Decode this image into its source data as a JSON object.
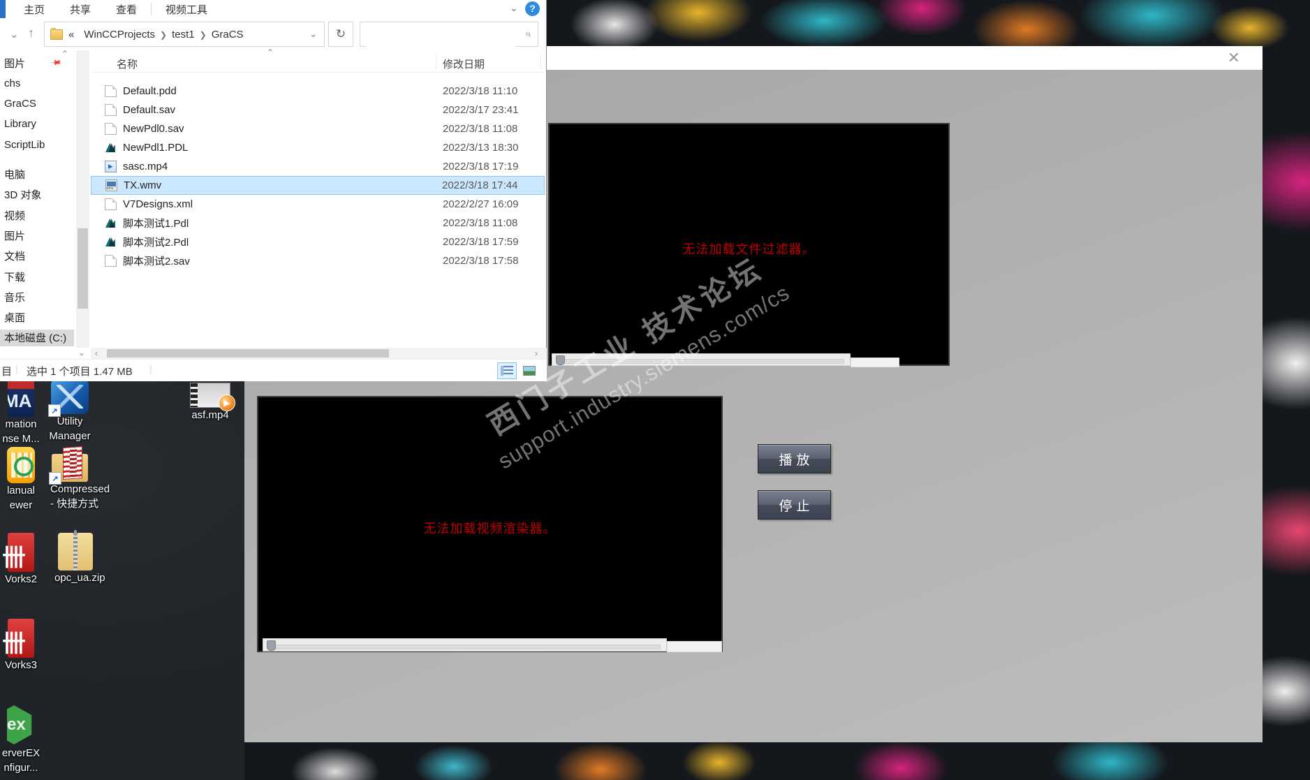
{
  "colors": {
    "selection_blue": "#cce8ff",
    "error_red": "#c00000",
    "accent_cyan": "#2fb7c6",
    "accent_magenta": "#d6247e",
    "accent_yellow": "#e8b42c",
    "wincc_gray": "#b0b0b0"
  },
  "explorer": {
    "ribbon_tabs": [
      {
        "label": "主页"
      },
      {
        "label": "共享"
      },
      {
        "label": "查看"
      },
      {
        "label": "视频工具",
        "divider_before": true
      }
    ],
    "ribbon": {
      "collapse_icon": "⌄",
      "help_label": "?"
    },
    "nav": {
      "back_icon": "⌄",
      "up_icon": "↑",
      "refresh_icon": "↻",
      "search_icon": "⌕"
    },
    "address": {
      "prefix": "«",
      "crumbs": [
        "WinCCProjects",
        "test1",
        "GraCS"
      ],
      "crumb_sep": "❯",
      "dropdown_icon": "⌄"
    },
    "search": {
      "placeholder": ""
    },
    "sidebar": {
      "items": [
        {
          "label": "图片",
          "pinned": true
        },
        {
          "label": "chs"
        },
        {
          "label": "GraCS"
        },
        {
          "label": "Library"
        },
        {
          "label": "ScriptLib"
        },
        {
          "label": "电脑",
          "group_break": true
        },
        {
          "label": "3D 对象"
        },
        {
          "label": "视频"
        },
        {
          "label": "图片"
        },
        {
          "label": "文档"
        },
        {
          "label": "下载"
        },
        {
          "label": "音乐"
        },
        {
          "label": "桌面"
        },
        {
          "label": "本地磁盘 (C:)",
          "selected": true
        }
      ]
    },
    "columns": {
      "name": "名称",
      "date": "修改日期",
      "sort_caret": "⌃"
    },
    "files": [
      {
        "name": "Default.pdd",
        "date": "2022/3/18 11:10",
        "icon": "doc"
      },
      {
        "name": "Default.sav",
        "date": "2022/3/17 23:41",
        "icon": "doc"
      },
      {
        "name": "NewPdl0.sav",
        "date": "2022/3/18 11:08",
        "icon": "doc"
      },
      {
        "name": "NewPdl1.PDL",
        "date": "2022/3/13 18:30",
        "icon": "pdl"
      },
      {
        "name": "sasc.mp4",
        "date": "2022/3/18 17:19",
        "icon": "mp4"
      },
      {
        "name": "TX.wmv",
        "date": "2022/3/18 17:44",
        "icon": "wmv",
        "selected": true
      },
      {
        "name": "V7Designs.xml",
        "date": "2022/2/27 16:09",
        "icon": "doc"
      },
      {
        "name": "脚本测试1.Pdl",
        "date": "2022/3/18 11:08",
        "icon": "pdl"
      },
      {
        "name": "脚本测试2.Pdl",
        "date": "2022/3/18 17:59",
        "icon": "pdl"
      },
      {
        "name": "脚本测试2.sav",
        "date": "2022/3/18 17:58",
        "icon": "doc"
      }
    ],
    "status": {
      "left_cut_text": "目",
      "selection_text": "选中 1 个项目  1.47 MB"
    }
  },
  "wincc": {
    "close_icon": "✕",
    "videos": [
      {
        "error_text": "无法加载文件过滤器。"
      },
      {
        "error_text": "无法加载视频渲染器。"
      }
    ],
    "buttons": {
      "play": "播放",
      "stop": "停止"
    },
    "watermark": {
      "line1": "西门子工业  技术论坛",
      "line2": "support.industry.siemens.com/cs"
    }
  },
  "desktop": {
    "icons": [
      {
        "icon": "automation-license-icon",
        "glyph_text": "MA",
        "label_lines": [
          "mation",
          "nse M..."
        ]
      },
      {
        "icon": "utility-manager-icon",
        "label_lines": [
          "Utility",
          "Manager"
        ]
      },
      {
        "icon": "media-file-icon",
        "play_glyph": "▶",
        "label_lines": [
          "asf.mp4"
        ]
      },
      {
        "icon": "manual-viewer-icon",
        "label_lines": [
          "lanual",
          "ewer"
        ]
      },
      {
        "icon": "compressed-shortcut-icon",
        "label_lines": [
          "Compressed",
          "- 快捷方式"
        ]
      },
      {
        "icon": "works2-icon",
        "glyph_text": "卌",
        "label_lines": [
          "Vorks2"
        ]
      },
      {
        "icon": "zip-folder-icon",
        "label_lines": [
          "opc_ua.zip"
        ]
      },
      {
        "icon": "works3-icon",
        "glyph_text": "卌",
        "label_lines": [
          "Vorks3"
        ]
      },
      {
        "icon": "serverex-icon",
        "glyph_text": "ex",
        "label_lines": [
          "erverEX",
          "nfigur..."
        ]
      }
    ]
  }
}
